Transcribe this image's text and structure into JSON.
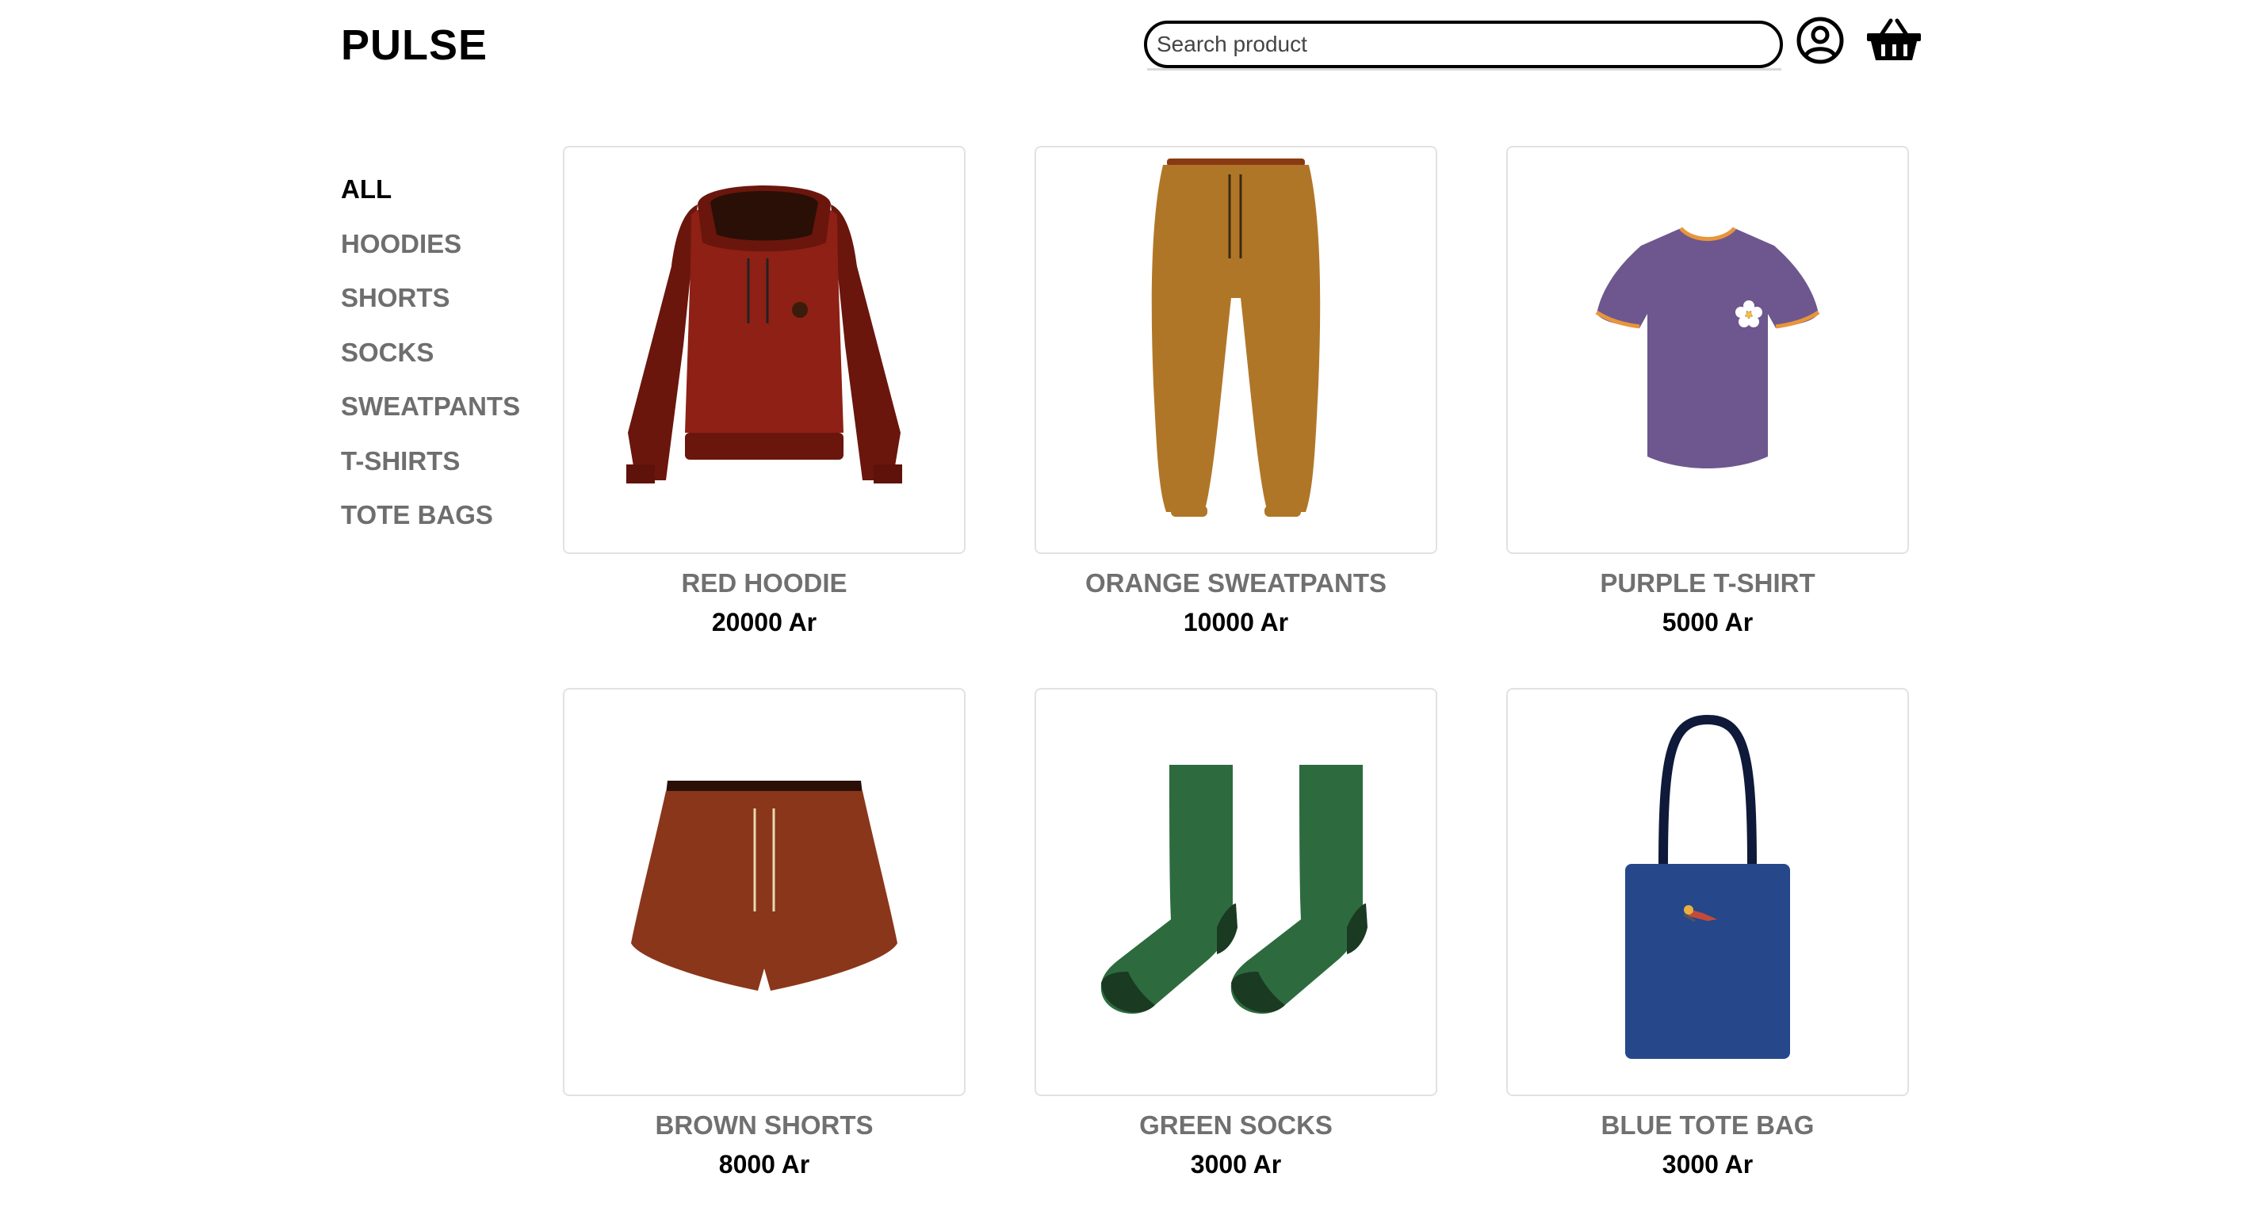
{
  "header": {
    "logo": "PULSE",
    "search_placeholder": "Search product",
    "user_icon": "user-circle-icon",
    "cart_icon": "basket-icon"
  },
  "sidebar": {
    "categories": [
      {
        "label": "ALL",
        "active": true
      },
      {
        "label": "HOODIES",
        "active": false
      },
      {
        "label": "SHORTS",
        "active": false
      },
      {
        "label": "SOCKS",
        "active": false
      },
      {
        "label": "SWEATPANTS",
        "active": false
      },
      {
        "label": "T-SHIRTS",
        "active": false
      },
      {
        "label": "TOTE BAGS",
        "active": false
      }
    ]
  },
  "products": [
    {
      "name": "RED HOODIE",
      "price": "20000 Ar",
      "image": "red-hoodie-image",
      "color": "#8e2015"
    },
    {
      "name": "ORANGE SWEATPANTS",
      "price": "10000 Ar",
      "image": "orange-sweatpants-image",
      "color": "#b07628"
    },
    {
      "name": "PURPLE T-SHIRT",
      "price": "5000 Ar",
      "image": "purple-tshirt-image",
      "color": "#6d578e"
    },
    {
      "name": "BROWN SHORTS",
      "price": "8000 Ar",
      "image": "brown-shorts-image",
      "color": "#8a361b"
    },
    {
      "name": "GREEN SOCKS",
      "price": "3000 Ar",
      "image": "green-socks-image",
      "color": "#2d6b3f"
    },
    {
      "name": "BLUE TOTE BAG",
      "price": "3000 Ar",
      "image": "blue-tote-bag-image",
      "color": "#26478a"
    }
  ]
}
